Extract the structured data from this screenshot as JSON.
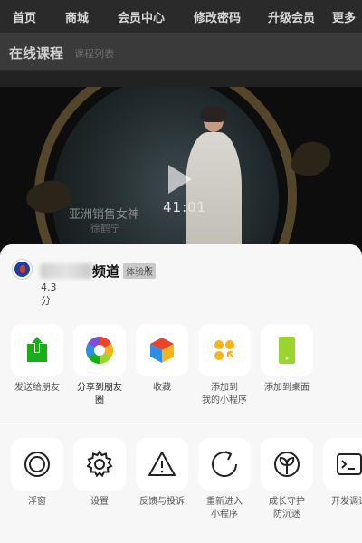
{
  "top_nav": {
    "items": [
      "首页",
      "商城",
      "会员中心",
      "修改密码",
      "升级会员",
      "更多"
    ]
  },
  "sub_header": {
    "title": "在线课程",
    "breadcrumb": "课程列表"
  },
  "video": {
    "duration": "41:01",
    "caption": "亚洲销售女神",
    "caption_sub": "徐鹤宁"
  },
  "app": {
    "name": "频道",
    "badge": "体验版",
    "rating": "4.3分"
  },
  "share_actions": [
    {
      "label": "发送给朋友",
      "icon": "share-upload-icon"
    },
    {
      "label": "分享到朋友\n圈",
      "icon": "moments-aperture-icon"
    },
    {
      "label": "收藏",
      "icon": "favorite-cube-icon"
    },
    {
      "label": "添加到\n我的小程序",
      "icon": "mini-program-icon"
    },
    {
      "label": "添加到桌面",
      "icon": "add-to-desktop-icon"
    }
  ],
  "system_actions": [
    {
      "label": "浮窗",
      "icon": "float-window-icon"
    },
    {
      "label": "设置",
      "icon": "gear-icon"
    },
    {
      "label": "反馈与投诉",
      "icon": "warning-triangle-icon"
    },
    {
      "label": "重新进入\n小程序",
      "icon": "reload-icon"
    },
    {
      "label": "成长守护\n防沉迷",
      "icon": "sprout-icon"
    },
    {
      "label": "开发调试",
      "icon": "terminal-icon"
    }
  ],
  "colors": {
    "green": "#1aad19",
    "orange": "#f5b41b",
    "blue": "#2b8fe6",
    "red": "#e8452c",
    "sheet": "#f7f7f7"
  }
}
